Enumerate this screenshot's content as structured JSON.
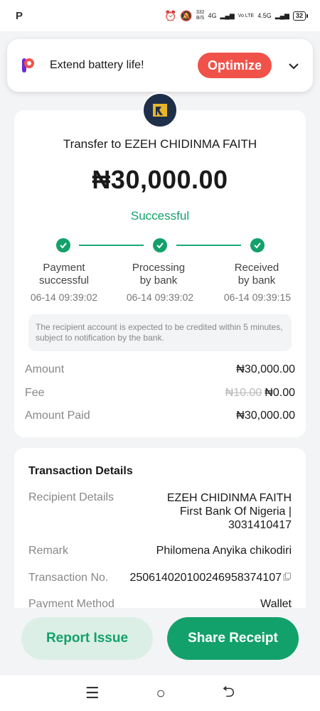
{
  "status_bar": {
    "left_glyph": "P",
    "speed_top": "332",
    "speed_bottom": "B/S",
    "net1": "4G",
    "net2": "Vo LTE",
    "net3": "4.5G",
    "battery": "32"
  },
  "banner": {
    "text": "Extend battery life!",
    "button_label": "Optimize"
  },
  "transfer": {
    "title": "Transfer to EZEH CHIDINMA FAITH",
    "amount": "₦30,000.00",
    "status": "Successful"
  },
  "timeline": [
    {
      "label_line1": "Payment",
      "label_line2": "successful",
      "time": "06-14 09:39:02"
    },
    {
      "label_line1": "Processing",
      "label_line2": "by bank",
      "time": "06-14 09:39:02"
    },
    {
      "label_line1": "Received",
      "label_line2": "by bank",
      "time": "06-14 09:39:15"
    }
  ],
  "note": "The recipient account is expected to be credited within 5 minutes, subject to notification by the bank.",
  "summary": {
    "amount_label": "Amount",
    "amount_value": "₦30,000.00",
    "fee_label": "Fee",
    "fee_original": "₦10.00",
    "fee_value": "₦0.00",
    "paid_label": "Amount Paid",
    "paid_value": "₦30,000.00"
  },
  "details": {
    "title": "Transaction Details",
    "recipient_label": "Recipient Details",
    "recipient_name": "EZEH CHIDINMA FAITH",
    "recipient_bank": "First Bank Of Nigeria |",
    "recipient_account": "3031410417",
    "remark_label": "Remark",
    "remark_value": "Philomena Anyika chikodiri",
    "txn_label": "Transaction No.",
    "txn_value": "250614020100246958374107",
    "method_label": "Payment Method",
    "method_value": "Wallet"
  },
  "actions": {
    "report": "Report Issue",
    "share": "Share Receipt"
  },
  "colors": {
    "brand_green": "#13a16b",
    "optimize_red": "#f0524a",
    "background": "#f3f4f6"
  }
}
